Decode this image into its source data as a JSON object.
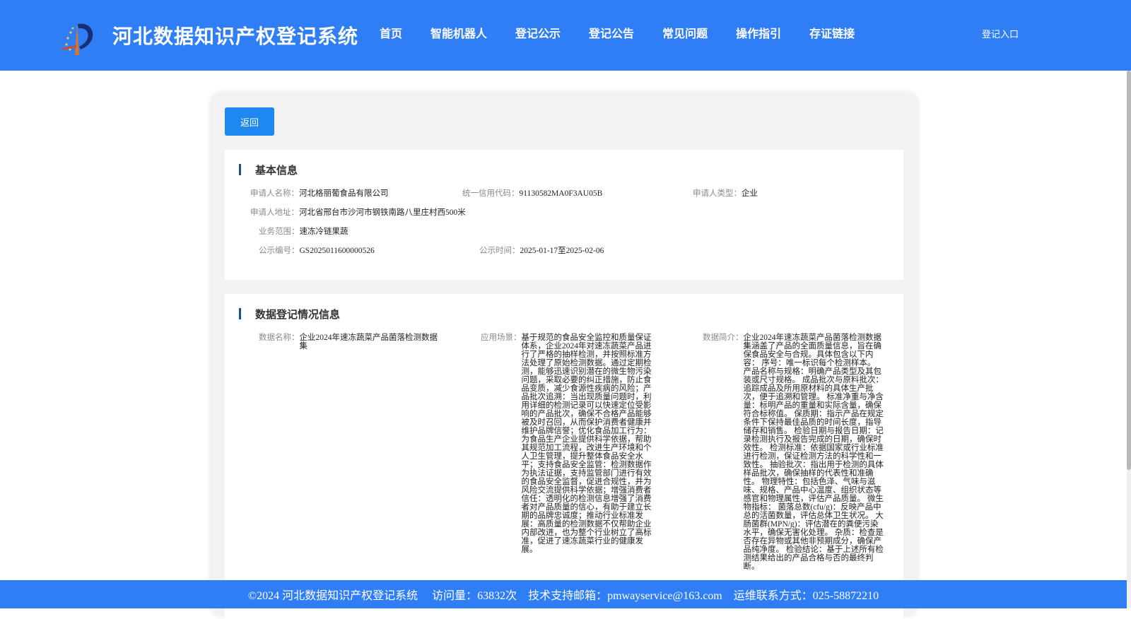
{
  "header": {
    "title": "河北数据知识产权登记系统",
    "nav": [
      "首页",
      "智能机器人",
      "登记公示",
      "登记公告",
      "常见问题",
      "操作指引",
      "存证链接"
    ],
    "login": "登记入口"
  },
  "back_label": "返回",
  "basic": {
    "title": "基本信息",
    "applicant_name_label": "申请人名称：",
    "applicant_name": "河北格丽葡食品有限公司",
    "credit_code_label": "统一信用代码：",
    "credit_code": "91130582MA0F3AU05B",
    "applicant_type_label": "申请人类型：",
    "applicant_type": "企业",
    "address_label": "申请人地址：",
    "address": "河北省邢台市沙河市钢铁南路八里庄村西500米",
    "scope_label": "业务范围：",
    "scope": "速冻冷链果蔬",
    "notice_no_label": "公示编号：",
    "notice_no": "GS2025011600000526",
    "notice_time_label": "公示时间：",
    "notice_time": "2025-01-17至2025-02-06"
  },
  "data": {
    "title": "数据登记情况信息",
    "name_label": "数据名称：",
    "name": "企业2024年速冻蔬菜产品菌落检测数据集",
    "scene_label": "应用场景：",
    "scene": "基于规范的食品安全监控和质量保证体系，企业2024年对速冻蔬菜产品进行了严格的抽样检测，并按照标准方法处理了原始检测数据。通过定期检测，能够迅速识别潜在的微生物污染问题，采取必要的纠正措施，防止食品变质，减少食源性疾病的风险；产品批次追溯：当出现质量问题时，利用详细的检测记录可以快速定位受影响的产品批次，确保不合格产品能够被及时召回，从而保护消费者健康并维护品牌信誉；优化食品加工行为：为食品生产企业提供科学依据，帮助其规范加工流程，改进生产环境和个人卫生管理，提升整体食品安全水平；支持食品安全监管：检测数据作为执法证据，支持监管部门进行有效的食品安全监督，促进合规性，并为风险交流提供科学依据；增强消费者信任：透明化的检测信息增强了消费者对产品质量的信心，有助于建立长期的品牌忠诚度；推动行业标准发展：高质量的检测数据不仅帮助企业内部改进，也为整个行业树立了高标准，促进了速冻蔬菜行业的健康发展。",
    "intro_label": "数据简介：",
    "intro": "企业2024年速冻蔬菜产品菌落检测数据集涵盖了产品的全面质量信息，旨在确保食品安全与合规。具体包含以下内容： 序号：唯一标识每个检测样本。 产品名称与规格：明确产品类型及其包装或尺寸规格。 成品批次与原料批次：追踪成品及所用原材料的具体生产批次，便于追溯和管理。 标准净重与净含量：标明产品的重量和实际含量，确保符合标称值。 保质期：指示产品在规定条件下保持最佳品质的时间长度，指导储存和销售。 检验日期与报告日期：记录检测执行及报告完成的日期，确保时效性。 检测标准：依据国家或行业标准进行检测，保证检测方法的科学性和一致性。 抽验批次：指出用于检测的具体样品批次，确保抽样的代表性和准确性。 物理特性：包括色泽、气味与滋味、规格、产品中心温度、组织状态等感官和物理属性，评估产品质量。 微生物指标： 菌落总数(cfu/g)：反映产品中总的活菌数量，评估总体卫生状况。 大肠菌群(MPN/g)：评估潜在的粪便污染水平，确保无害化处理。 杂质：检查是否存在异物或其他非预期成分，确保产品纯净度。 检验结论：基于上述所有检测结果给出的产品合格与否的最终判断。"
  },
  "footer": {
    "text": "©2024 河北数据知识产权登记系统     访问量：63832次    技术支持邮箱：pmwayservice@163.com    运维联系方式：025-58872210"
  },
  "colors": {
    "header_bg": "#2f7ef5",
    "button_bg": "#1e88f0",
    "section_bar": "#1a4f8b",
    "footer_bg": "#2f7ef5"
  },
  "icons": {
    "logo": "hebei-logo-icon"
  }
}
